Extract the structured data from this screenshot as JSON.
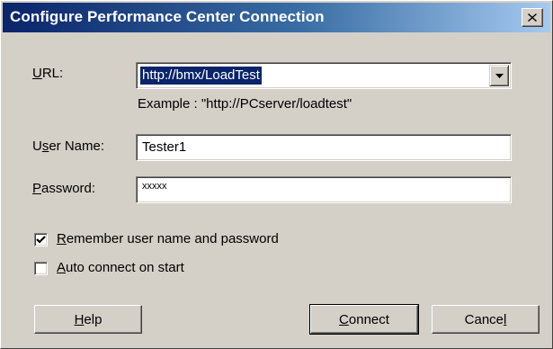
{
  "window": {
    "title": "Configure Performance Center Connection",
    "close_icon": "close-icon",
    "titlebar_colors": [
      "#0a246a",
      "#a6caf0"
    ]
  },
  "url": {
    "label_mnemonic": "U",
    "label_rest": "RL:",
    "value": "http://bmx/LoadTest",
    "dropdown_icon": "chevron-down-icon",
    "example": "Example : \"http://PCserver/loadtest\""
  },
  "username": {
    "label_pre": "U",
    "label_mnemonic": "s",
    "label_rest": "er Name:",
    "value": "Tester1"
  },
  "password": {
    "label_mnemonic": "P",
    "label_rest": "assword:",
    "value": "xxxxx"
  },
  "options": {
    "remember": {
      "mnemonic": "R",
      "rest": "emember user name and password",
      "checked": true
    },
    "autoconnect": {
      "mnemonic": "A",
      "rest": "uto connect on start",
      "checked": false
    }
  },
  "buttons": {
    "help": {
      "mnemonic": "H",
      "rest": "elp"
    },
    "connect": {
      "mnemonic": "C",
      "rest": "onnect"
    },
    "cancel": {
      "pre": "Cance",
      "mnemonic": "l"
    }
  }
}
